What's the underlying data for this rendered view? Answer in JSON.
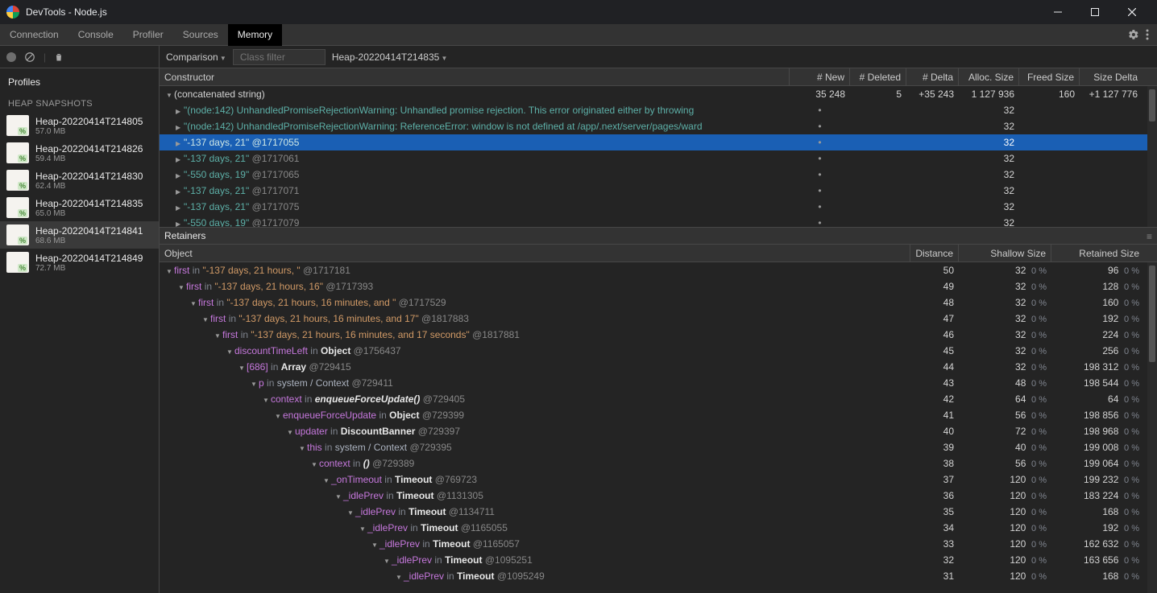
{
  "titlebar": {
    "title": "DevTools - Node.js"
  },
  "tabs": [
    "Connection",
    "Console",
    "Profiler",
    "Sources",
    "Memory"
  ],
  "active_tab": "Memory",
  "filterbar": {
    "mode": "Comparison",
    "class_filter_placeholder": "Class filter",
    "baseline": "Heap-20220414T214835"
  },
  "sidebar": {
    "profiles_title": "Profiles",
    "section": "HEAP SNAPSHOTS",
    "snapshots": [
      {
        "name": "Heap-20220414T214805",
        "size": "57.0 MB"
      },
      {
        "name": "Heap-20220414T214826",
        "size": "59.4 MB"
      },
      {
        "name": "Heap-20220414T214830",
        "size": "62.4 MB"
      },
      {
        "name": "Heap-20220414T214835",
        "size": "65.0 MB"
      },
      {
        "name": "Heap-20220414T214841",
        "size": "68.6 MB"
      },
      {
        "name": "Heap-20220414T214849",
        "size": "72.7 MB"
      }
    ],
    "selected_snapshot": 4
  },
  "constructor_table": {
    "headers": [
      "Constructor",
      "# New",
      "# Deleted",
      "# Delta",
      "Alloc. Size",
      "Freed Size",
      "Size Delta"
    ],
    "group_row": {
      "label": "(concatenated string)",
      "new": "35 248",
      "deleted": "5",
      "delta": "+35 243",
      "alloc": "1 127 936",
      "freed": "160",
      "sizedelta": "+1 127 776"
    },
    "rows": [
      {
        "text": "\"(node:142) UnhandledPromiseRejectionWarning: Unhandled promise rejection. This error originated either by throwing",
        "new": "•",
        "alloc": "32"
      },
      {
        "text": "\"(node:142) UnhandledPromiseRejectionWarning: ReferenceError: window is not defined at /app/.next/server/pages/ward",
        "new": "•",
        "alloc": "32"
      },
      {
        "text": "\"-137 days, 21\"",
        "id": "@1717055",
        "new": "•",
        "alloc": "32",
        "selected": true
      },
      {
        "text": "\"-137 days, 21\"",
        "id": "@1717061",
        "new": "•",
        "alloc": "32"
      },
      {
        "text": "\"-550 days, 19\"",
        "id": "@1717065",
        "new": "•",
        "alloc": "32"
      },
      {
        "text": "\"-137 days, 21\"",
        "id": "@1717071",
        "new": "•",
        "alloc": "32"
      },
      {
        "text": "\"-137 days, 21\"",
        "id": "@1717075",
        "new": "•",
        "alloc": "32"
      },
      {
        "text": "\"-550 days, 19\"",
        "id": "@1717079",
        "new": "•",
        "alloc": "32"
      }
    ]
  },
  "retainers": {
    "title": "Retainers",
    "headers": [
      "Object",
      "Distance",
      "Shallow Size",
      "Retained Size"
    ],
    "rows": [
      {
        "indent": 0,
        "prop": "first",
        "in": "in",
        "target": "\"-137 days, 21 hours, \"",
        "id": "@1717181",
        "distance": "50",
        "shallow": "32",
        "shallow_pct": "0 %",
        "retained": "96",
        "retained_pct": "0 %"
      },
      {
        "indent": 1,
        "prop": "first",
        "in": "in",
        "target": "\"-137 days, 21 hours, 16\"",
        "id": "@1717393",
        "distance": "49",
        "shallow": "32",
        "shallow_pct": "0 %",
        "retained": "128",
        "retained_pct": "0 %"
      },
      {
        "indent": 2,
        "prop": "first",
        "in": "in",
        "target": "\"-137 days, 21 hours, 16 minutes, and \"",
        "id": "@1717529",
        "distance": "48",
        "shallow": "32",
        "shallow_pct": "0 %",
        "retained": "160",
        "retained_pct": "0 %"
      },
      {
        "indent": 3,
        "prop": "first",
        "in": "in",
        "target": "\"-137 days, 21 hours, 16 minutes, and 17\"",
        "id": "@1817883",
        "distance": "47",
        "shallow": "32",
        "shallow_pct": "0 %",
        "retained": "192",
        "retained_pct": "0 %"
      },
      {
        "indent": 4,
        "prop": "first",
        "in": "in",
        "target": "\"-137 days, 21 hours, 16 minutes, and 17 seconds\"",
        "id": "@1817881",
        "distance": "46",
        "shallow": "32",
        "shallow_pct": "0 %",
        "retained": "224",
        "retained_pct": "0 %"
      },
      {
        "indent": 5,
        "prop": "discountTimeLeft",
        "in": "in",
        "target_bold": "Object",
        "id": "@1756437",
        "distance": "45",
        "shallow": "32",
        "shallow_pct": "0 %",
        "retained": "256",
        "retained_pct": "0 %"
      },
      {
        "indent": 6,
        "prop": "[686]",
        "in": "in",
        "target_bold": "Array",
        "id": "@729415",
        "distance": "44",
        "shallow": "32",
        "shallow_pct": "0 %",
        "retained": "198 312",
        "retained_pct": "0 %"
      },
      {
        "indent": 7,
        "prop": "p",
        "in": "in",
        "target_plain": "system / Context",
        "id": "@729411",
        "distance": "43",
        "shallow": "48",
        "shallow_pct": "0 %",
        "retained": "198 544",
        "retained_pct": "0 %"
      },
      {
        "indent": 8,
        "prop": "context",
        "in": "in",
        "target_italic": "enqueueForceUpdate()",
        "id": "@729405",
        "distance": "42",
        "shallow": "64",
        "shallow_pct": "0 %",
        "retained": "64",
        "retained_pct": "0 %"
      },
      {
        "indent": 9,
        "prop": "enqueueForceUpdate",
        "in": "in",
        "target_bold": "Object",
        "id": "@729399",
        "distance": "41",
        "shallow": "56",
        "shallow_pct": "0 %",
        "retained": "198 856",
        "retained_pct": "0 %"
      },
      {
        "indent": 10,
        "prop": "updater",
        "in": "in",
        "target_bold": "DiscountBanner",
        "id": "@729397",
        "distance": "40",
        "shallow": "72",
        "shallow_pct": "0 %",
        "retained": "198 968",
        "retained_pct": "0 %"
      },
      {
        "indent": 11,
        "prop": "this",
        "in": "in",
        "target_plain": "system / Context",
        "id": "@729395",
        "distance": "39",
        "shallow": "40",
        "shallow_pct": "0 %",
        "retained": "199 008",
        "retained_pct": "0 %"
      },
      {
        "indent": 12,
        "prop": "context",
        "in": "in",
        "target_italic": "()",
        "id": "@729389",
        "distance": "38",
        "shallow": "56",
        "shallow_pct": "0 %",
        "retained": "199 064",
        "retained_pct": "0 %"
      },
      {
        "indent": 13,
        "prop": "_onTimeout",
        "in": "in",
        "target_bold": "Timeout",
        "id": "@769723",
        "distance": "37",
        "shallow": "120",
        "shallow_pct": "0 %",
        "retained": "199 232",
        "retained_pct": "0 %"
      },
      {
        "indent": 14,
        "prop": "_idlePrev",
        "in": "in",
        "target_bold": "Timeout",
        "id": "@1131305",
        "distance": "36",
        "shallow": "120",
        "shallow_pct": "0 %",
        "retained": "183 224",
        "retained_pct": "0 %"
      },
      {
        "indent": 15,
        "prop": "_idlePrev",
        "in": "in",
        "target_bold": "Timeout",
        "id": "@1134711",
        "distance": "35",
        "shallow": "120",
        "shallow_pct": "0 %",
        "retained": "168",
        "retained_pct": "0 %"
      },
      {
        "indent": 16,
        "prop": "_idlePrev",
        "in": "in",
        "target_bold": "Timeout",
        "id": "@1165055",
        "distance": "34",
        "shallow": "120",
        "shallow_pct": "0 %",
        "retained": "192",
        "retained_pct": "0 %"
      },
      {
        "indent": 17,
        "prop": "_idlePrev",
        "in": "in",
        "target_bold": "Timeout",
        "id": "@1165057",
        "distance": "33",
        "shallow": "120",
        "shallow_pct": "0 %",
        "retained": "162 632",
        "retained_pct": "0 %"
      },
      {
        "indent": 18,
        "prop": "_idlePrev",
        "in": "in",
        "target_bold": "Timeout",
        "id": "@1095251",
        "distance": "32",
        "shallow": "120",
        "shallow_pct": "0 %",
        "retained": "163 656",
        "retained_pct": "0 %"
      },
      {
        "indent": 19,
        "prop": "_idlePrev",
        "in": "in",
        "target_bold": "Timeout",
        "id": "@1095249",
        "distance": "31",
        "shallow": "120",
        "shallow_pct": "0 %",
        "retained": "168",
        "retained_pct": "0 %"
      }
    ]
  }
}
